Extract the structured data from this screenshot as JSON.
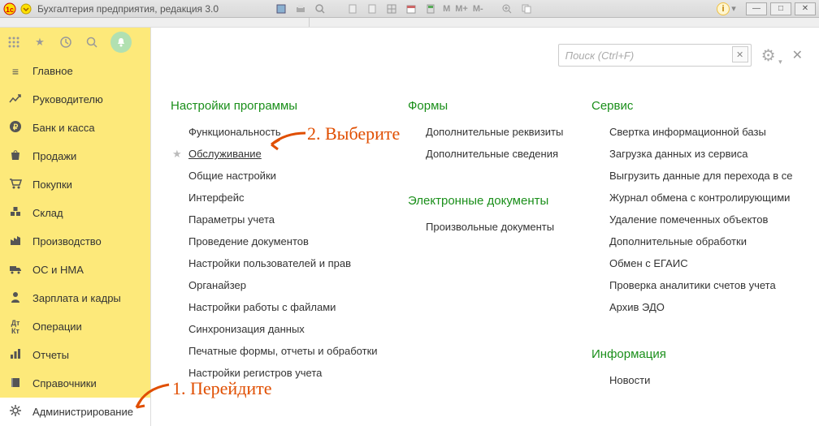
{
  "titlebar": {
    "title": "Бухгалтерия предприятия, редакция 3.0",
    "m_labels": [
      "M",
      "M+",
      "M-"
    ]
  },
  "search": {
    "placeholder": "Поиск (Ctrl+F)"
  },
  "sidebar": {
    "items": [
      {
        "label": "Главное"
      },
      {
        "label": "Руководителю"
      },
      {
        "label": "Банк и касса"
      },
      {
        "label": "Продажи"
      },
      {
        "label": "Покупки"
      },
      {
        "label": "Склад"
      },
      {
        "label": "Производство"
      },
      {
        "label": "ОС и НМА"
      },
      {
        "label": "Зарплата и кадры"
      },
      {
        "label": "Операции"
      },
      {
        "label": "Отчеты"
      },
      {
        "label": "Справочники"
      },
      {
        "label": "Администрирование"
      }
    ]
  },
  "col1": {
    "title": "Настройки программы",
    "items": [
      "Функциональность",
      "Обслуживание",
      "Общие настройки",
      "Интерфейс",
      "Параметры учета",
      "Проведение документов",
      "Настройки пользователей и прав",
      "Органайзер",
      "Настройки работы с файлами",
      "Синхронизация данных",
      "Печатные формы, отчеты и обработки",
      "Настройки регистров учета"
    ]
  },
  "col2": {
    "sec1_title": "Формы",
    "sec1_items": [
      "Дополнительные реквизиты",
      "Дополнительные сведения"
    ],
    "sec2_title": "Электронные документы",
    "sec2_items": [
      "Произвольные документы"
    ]
  },
  "col3": {
    "sec1_title": "Сервис",
    "sec1_items": [
      "Свертка информационной базы",
      "Загрузка данных из сервиса",
      "Выгрузить данные для перехода в се",
      "Журнал обмена с контролирующими",
      "Удаление помеченных объектов",
      "Дополнительные обработки",
      "Обмен с ЕГАИС",
      "Проверка аналитики счетов учета",
      "Архив ЭДО"
    ],
    "sec2_title": "Информация",
    "sec2_items": [
      "Новости"
    ]
  },
  "annotations": {
    "a1": "1. Перейдите",
    "a2": "2. Выберите"
  }
}
